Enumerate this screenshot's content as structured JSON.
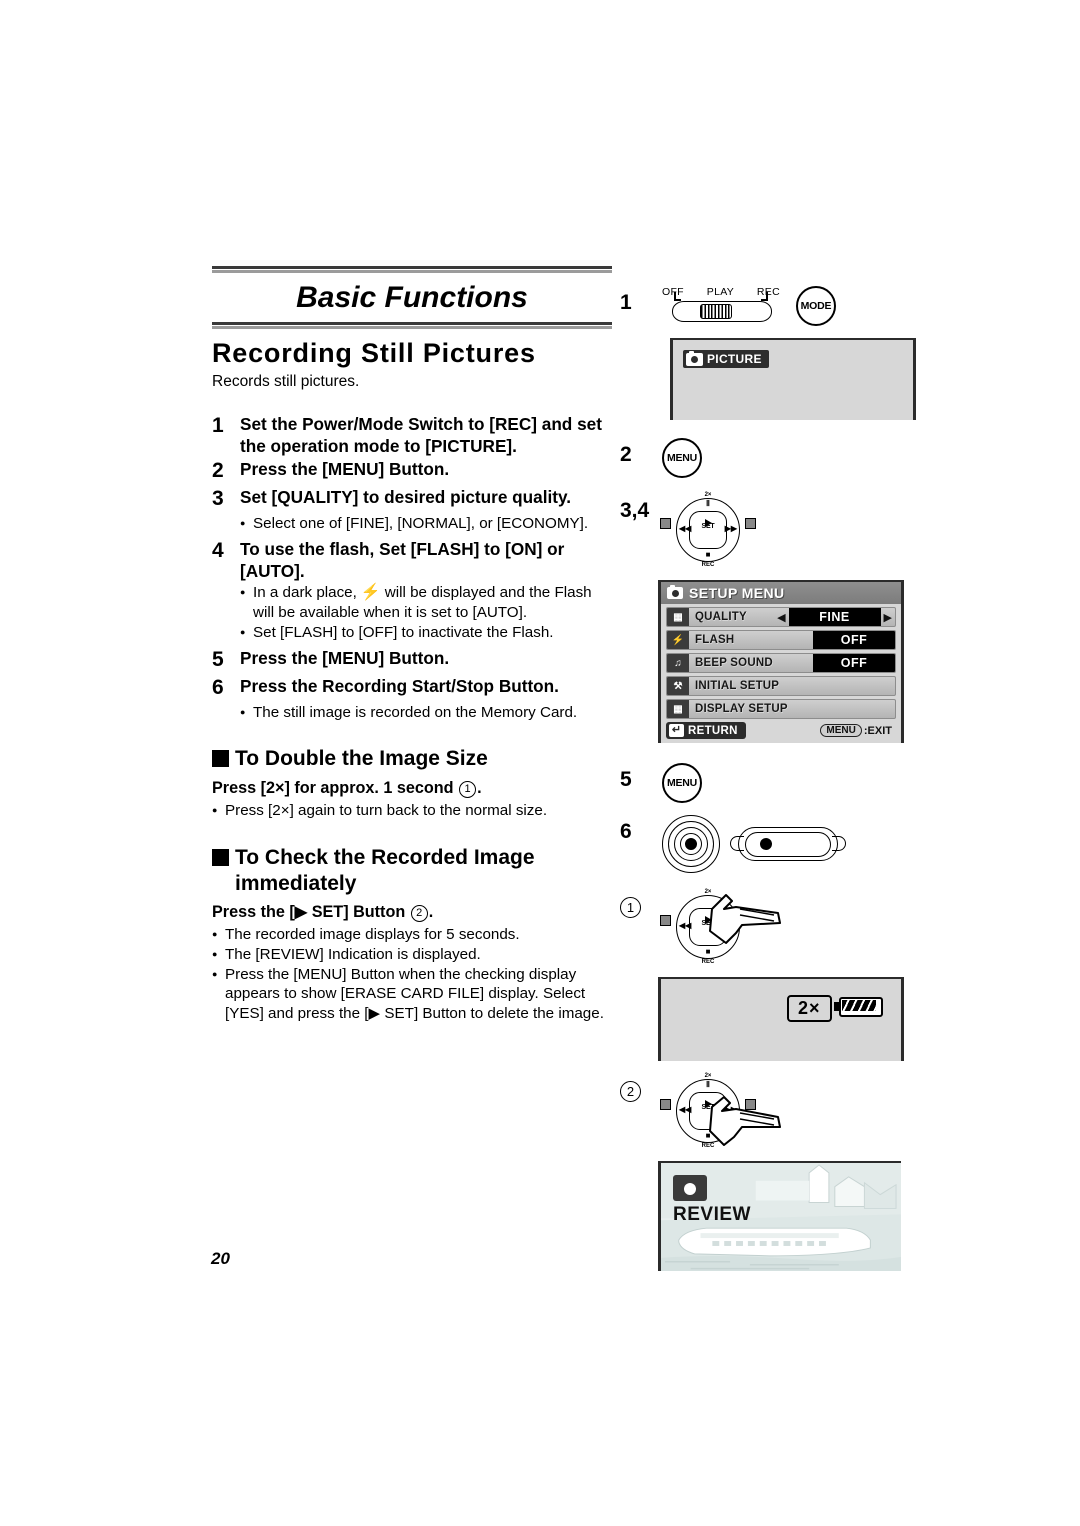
{
  "page": {
    "number": "20",
    "chapter_title": "Basic Functions",
    "section_title": "Recording Still Pictures",
    "lead": "Records still pictures."
  },
  "steps": [
    {
      "num": "1",
      "text": "Set the Power/Mode Switch to [REC] and set the operation mode to [PICTURE].",
      "bullets": []
    },
    {
      "num": "2",
      "text": "Press the [MENU] Button.",
      "bullets": []
    },
    {
      "num": "3",
      "text": "Set [QUALITY] to desired picture quality.",
      "bullets": [
        "Select one of [FINE], [NORMAL], or [ECONOMY]."
      ]
    },
    {
      "num": "4",
      "text": "To use the flash, Set [FLASH] to [ON] or [AUTO].",
      "bullets": [
        "Set [FLASH] to [OFF] to inactivate the Flash."
      ]
    },
    {
      "num": "5",
      "text": "Press the [MENU] Button.",
      "bullets": []
    },
    {
      "num": "6",
      "text": "Press the Recording Start/Stop Button.",
      "bullets": [
        "The still image is recorded on the Memory Card."
      ]
    }
  ],
  "flash_bullet": {
    "pre": "In a dark place,",
    "icon": "flash-bolt-icon",
    "post": "will be displayed and the Flash will be available when it is set to [AUTO]."
  },
  "subsections": [
    {
      "heading": "To Double the Image Size",
      "press_line_pre": "Press [2×] for approx. 1 second",
      "press_line_marker": "1",
      "press_line_post": ".",
      "bullets": [
        "Press [2×] again to turn back to the normal size."
      ]
    },
    {
      "heading": "To Check the Recorded Image immediately",
      "press_line_pre": "Press the [▶ SET] Button",
      "press_line_marker": "2",
      "press_line_post": ".",
      "bullets": [
        "The recorded image displays for 5 seconds.",
        "The [REVIEW] Indication is displayed.",
        "Press the [MENU] Button when the checking display appears to show [ERASE CARD FILE] display. Select [YES] and press the [▶ SET] Button to delete the image."
      ]
    }
  ],
  "figures": {
    "step1": {
      "num": "1",
      "switch_labels": [
        "OFF",
        "PLAY",
        "REC"
      ],
      "mode_button_label": "MODE",
      "lcd_tag": "PICTURE"
    },
    "step2": {
      "num": "2",
      "menu_button_label": "MENU"
    },
    "step34": {
      "num": "3,4"
    },
    "step5": {
      "num": "5",
      "menu_button_label": "MENU"
    },
    "step6": {
      "num": "6"
    },
    "marker1": {
      "num": "1",
      "lcd_zoom_label": "2×"
    },
    "marker2": {
      "num": "2",
      "lcd_review_label": "REVIEW"
    }
  },
  "setup_menu": {
    "title": "SETUP MENU",
    "rows": [
      {
        "icon": "quality-grid-icon",
        "label": "QUALITY",
        "value": "FINE",
        "has_arrows": true
      },
      {
        "icon": "flash-bolt-icon",
        "label": "FLASH",
        "value": "OFF",
        "has_arrows": false
      },
      {
        "icon": "beep-sound-icon",
        "label": "BEEP SOUND",
        "value": "OFF",
        "has_arrows": false
      },
      {
        "icon": "initial-setup-icon",
        "label": "INITIAL SETUP",
        "value": "",
        "has_arrows": false
      },
      {
        "icon": "display-setup-icon",
        "label": "DISPLAY SETUP",
        "value": "",
        "has_arrows": false
      }
    ],
    "return_label": "RETURN",
    "exit_key": "MENU",
    "exit_label": ":EXIT"
  },
  "pad_labels": {
    "top": "2×",
    "pause": "Ⅱ",
    "left": "◀◀",
    "right": "▶▶",
    "center": "SET",
    "stop": "■",
    "bottom": "REC"
  },
  "colors": {
    "lcd_background": "#d7d7d7",
    "menu_title_bar": "#8f8f8f",
    "menu_value_bg": "#000000",
    "rule_dark": "#3a3a3a",
    "rule_gray": "#9b9b9b"
  }
}
